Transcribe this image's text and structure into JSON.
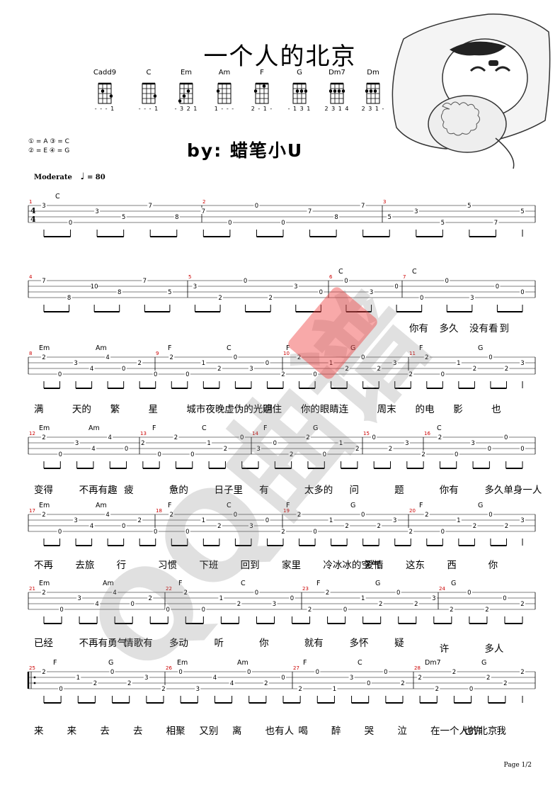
{
  "title": "一个人的北京",
  "chords": [
    {
      "name": "Cadd9",
      "fingering": "- - - 1"
    },
    {
      "name": "C",
      "fingering": "- - - 1"
    },
    {
      "name": "Em",
      "fingering": "- 3 2 1"
    },
    {
      "name": "Am",
      "fingering": "1 - - -"
    },
    {
      "name": "F",
      "fingering": "2 - 1 -"
    },
    {
      "name": "G",
      "fingering": "- 1 3 1"
    },
    {
      "name": "Dm7",
      "fingering": "2 3 1 4"
    },
    {
      "name": "Dm",
      "fingering": "2 3 1 -"
    }
  ],
  "tuning": [
    "① = A   ③ = C",
    "② = E   ④ = G"
  ],
  "author": "by: 蜡笔小U",
  "tempo": {
    "label": "Moderate",
    "bpm": "= 80"
  },
  "page": "Page 1/2",
  "watermark": "QQ曲谱",
  "systems": [
    {
      "measures": [
        "1",
        "2",
        "3"
      ],
      "chords": [
        "C",
        "",
        "",
        "",
        "",
        "",
        "",
        ""
      ],
      "lyrics": []
    },
    {
      "measures": [
        "4",
        "5",
        "6",
        "7"
      ],
      "chords": [
        "C",
        "C"
      ],
      "lyrics": [
        "你有",
        "多久",
        "没有看",
        "到"
      ]
    },
    {
      "measures": [
        "8",
        "9",
        "10",
        "11"
      ],
      "chords": [
        "Em",
        "Am",
        "F",
        "C",
        "F",
        "G",
        "F",
        "G"
      ],
      "lyrics": [
        "满",
        "天的",
        "繁",
        "星",
        "城市夜晚",
        "虚伪的光明",
        "遮住",
        "你的眼睛",
        "连",
        "周末",
        "的电",
        "影",
        "也"
      ]
    },
    {
      "measures": [
        "12",
        "13",
        "14",
        "15",
        "16"
      ],
      "chords": [
        "Em",
        "Am",
        "F",
        "C",
        "F",
        "G",
        "C"
      ],
      "lyrics": [
        "变得",
        "不再有趣",
        "疲",
        "惫的",
        "日子里",
        "有",
        "太多的",
        "问",
        "题",
        "你有",
        "多久单身一人"
      ]
    },
    {
      "measures": [
        "17",
        "18",
        "19",
        "20"
      ],
      "chords": [
        "Em",
        "Am",
        "F",
        "C",
        "F",
        "G",
        "F",
        "G"
      ],
      "lyrics": [
        "不再",
        "去旅",
        "行",
        "习惯",
        "下班",
        "回到",
        "家里",
        "冷冰冰的空气",
        "爱情",
        "这东",
        "西",
        "你"
      ]
    },
    {
      "measures": [
        "21",
        "22",
        "23",
        "24"
      ],
      "chords": [
        "Em",
        "Am",
        "F",
        "C",
        "F",
        "G",
        "G"
      ],
      "lyrics": [
        "已经",
        "不再有勇气",
        "情歌有",
        "多动",
        "听",
        "你",
        "就有",
        "多怀",
        "疑",
        "许",
        "多人"
      ]
    },
    {
      "measures": [
        "25",
        "26",
        "27",
        "28"
      ],
      "chords": [
        "F",
        "G",
        "Em",
        "Am",
        "F",
        "C",
        "Dm7",
        "G"
      ],
      "lyrics": [
        "来",
        "来",
        "去",
        "去",
        "相聚",
        "又别",
        "离",
        "也有人",
        "喝",
        "醉",
        "哭",
        "泣",
        "在一个人的北京",
        "也许",
        "我"
      ]
    }
  ]
}
